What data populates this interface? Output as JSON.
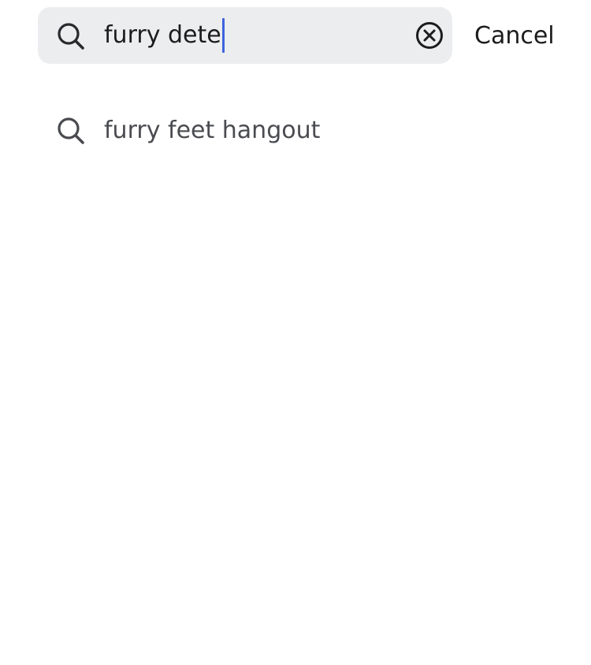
{
  "search": {
    "query": "furry dete",
    "clear_icon": "clear-circle-x-icon",
    "search_icon": "search-icon"
  },
  "header": {
    "cancel_label": "Cancel"
  },
  "suggestions": [
    {
      "label": "furry feet hangout",
      "icon": "search-icon"
    }
  ],
  "colors": {
    "search_bar_bg": "#ecedef",
    "caret": "#3d63dd",
    "primary_text": "#1c1c1e",
    "suggestion_text": "#4a4b50"
  }
}
